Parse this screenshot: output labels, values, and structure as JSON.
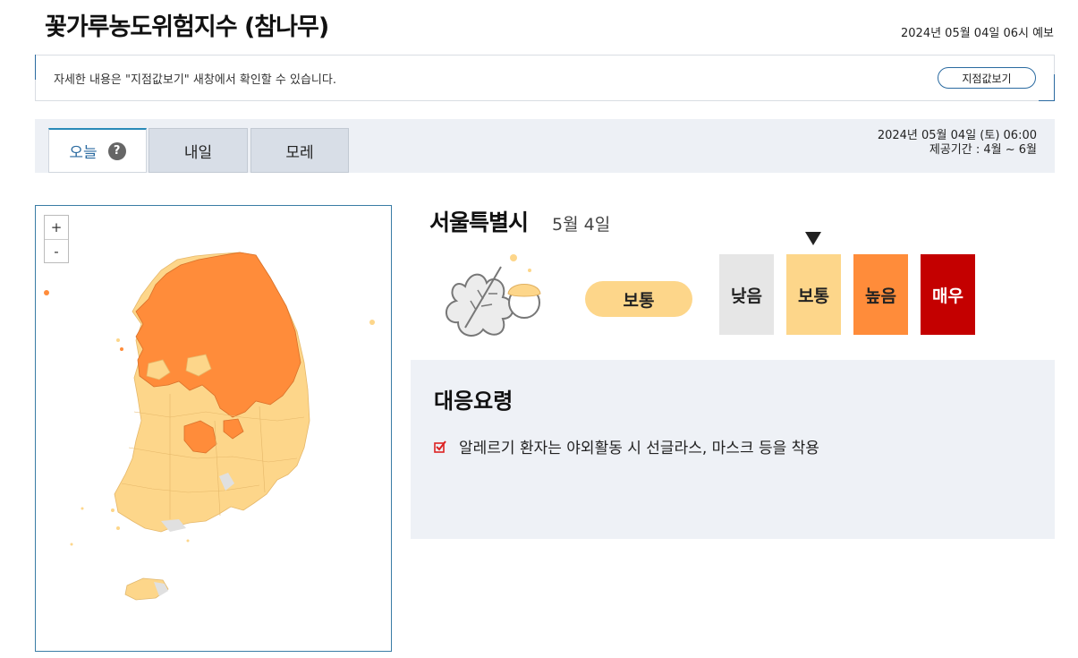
{
  "header": {
    "title": "꽃가루농도위험지수 (참나무)",
    "forecast_time": "2024년 05월 04일 06시 예보"
  },
  "notice": {
    "text": "자세한 내용은 \"지점값보기\" 새창에서 확인할 수 있습니다.",
    "button_label": "지점값보기"
  },
  "tabs": [
    {
      "label": "오늘",
      "active": true
    },
    {
      "label": "내일",
      "active": false
    },
    {
      "label": "모레",
      "active": false
    }
  ],
  "help_icon": "?",
  "date_info": {
    "datetime": "2024년 05월 04일 (토) 06:00",
    "period": "제공기간 : 4월 ~ 6월"
  },
  "map": {
    "zoom_in": "+",
    "zoom_out": "-"
  },
  "region": {
    "name": "서울특별시",
    "date": "5월 4일",
    "level": "보통"
  },
  "scale": [
    {
      "label": "낮음",
      "color": "#e6e6e6",
      "text_color": "#222222"
    },
    {
      "label": "보통",
      "color": "#fdd68a",
      "text_color": "#222222"
    },
    {
      "label": "높음",
      "color": "#ff8c3a",
      "text_color": "#222222"
    },
    {
      "label": "매우",
      "color": "#c40000",
      "text_color": "#ffffff"
    }
  ],
  "scale_selected": "보통",
  "guide": {
    "title": "대응요령",
    "items": [
      "알레르기 환자는 야외활동 시 선글라스, 마스크 등을 착용"
    ]
  },
  "colors": {
    "accent": "#2a6aa0",
    "medium": "#fdd68a",
    "high": "#ff8c3a",
    "very_high": "#c40000",
    "low": "#e6e6e6"
  }
}
